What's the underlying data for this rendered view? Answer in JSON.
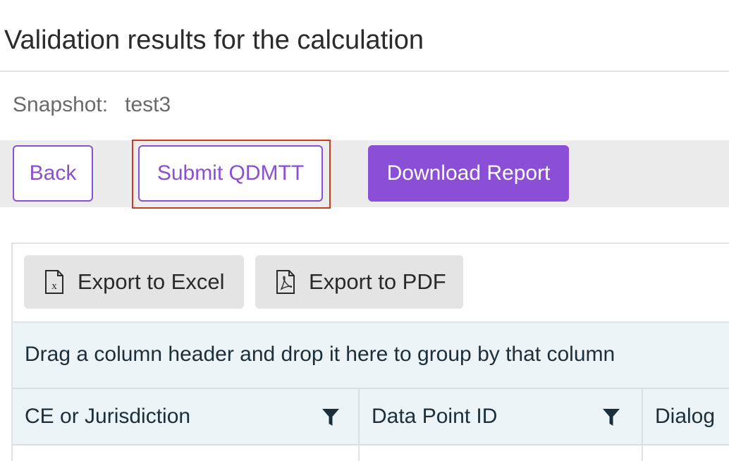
{
  "page": {
    "title": "Validation results for the calculation"
  },
  "snapshot": {
    "label": "Snapshot:",
    "value": "test3"
  },
  "toolbar": {
    "back_label": "Back",
    "submit_label": "Submit QDMTT",
    "download_label": "Download Report"
  },
  "grid": {
    "export_excel_label": "Export to Excel",
    "export_pdf_label": "Export to PDF",
    "group_panel_text": "Drag a column header and drop it here to group by that column",
    "columns": [
      {
        "label": "CE or Jurisdiction",
        "icon": "filter-icon"
      },
      {
        "label": "Data Point ID",
        "icon": "filter-icon"
      },
      {
        "label": "Dialog"
      }
    ]
  },
  "colors": {
    "accent": "#8a4fd6",
    "highlight": "#cc3a1c",
    "grid_header_bg": "#edf4f7"
  }
}
